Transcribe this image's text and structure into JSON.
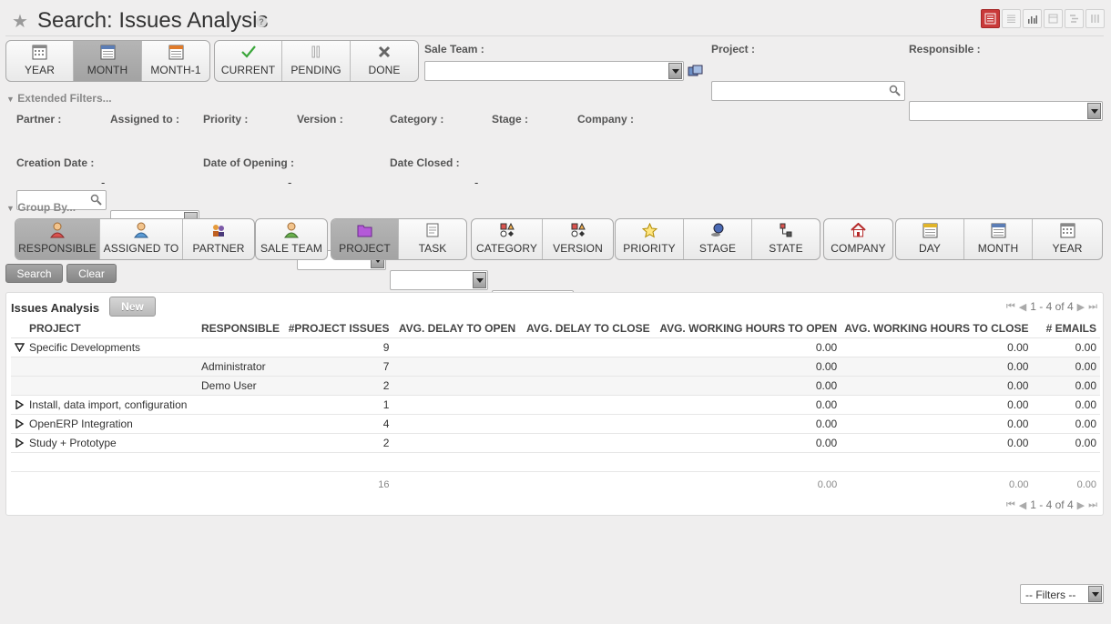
{
  "header": {
    "title": "Search: Issues Analysis",
    "help": "?"
  },
  "view_switch": [
    "list-view-icon",
    "form-view-icon",
    "graph-view-icon",
    "calendar-view-icon",
    "gantt-view-icon",
    "kanban-view-icon"
  ],
  "filters": {
    "period": [
      {
        "label": "YEAR",
        "icon": "calendar-icon",
        "active": false
      },
      {
        "label": "MONTH",
        "icon": "calendar-icon",
        "active": true
      },
      {
        "label": "MONTH-1",
        "icon": "calendar-icon",
        "active": false
      }
    ],
    "state": [
      {
        "label": "CURRENT",
        "icon": "check-icon"
      },
      {
        "label": "PENDING",
        "icon": "pause-icon"
      },
      {
        "label": "DONE",
        "icon": "cross-icon"
      }
    ]
  },
  "fields": {
    "sale_team": {
      "label": "Sale Team :",
      "value": ""
    },
    "project": {
      "label": "Project :",
      "value": ""
    },
    "responsible": {
      "label": "Responsible :",
      "value": ""
    }
  },
  "extended": {
    "toggle": "Extended Filters...",
    "partner": "Partner :",
    "assigned_to": "Assigned to :",
    "priority": "Priority :",
    "version": "Version :",
    "category": "Category :",
    "stage": "Stage :",
    "company": "Company :",
    "creation_date": "Creation Date :",
    "date_opening": "Date of Opening :",
    "date_closed": "Date Closed :",
    "dash": "-"
  },
  "group_by": {
    "toggle": "Group By...",
    "groups": [
      [
        {
          "label": "RESPONSIBLE",
          "icon": "user-icon",
          "active": true
        },
        {
          "label": "ASSIGNED TO",
          "icon": "user-icon",
          "active": false
        },
        {
          "label": "PARTNER",
          "icon": "partner-icon",
          "active": false
        }
      ],
      [
        {
          "label": "SALE TEAM",
          "icon": "user-icon",
          "active": false
        }
      ],
      [
        {
          "label": "PROJECT",
          "icon": "folder-icon",
          "active": true
        },
        {
          "label": "TASK",
          "icon": "task-icon",
          "active": false
        }
      ],
      [
        {
          "label": "CATEGORY",
          "icon": "shapes-icon",
          "active": false
        },
        {
          "label": "VERSION",
          "icon": "shapes-icon",
          "active": false
        }
      ],
      [
        {
          "label": "PRIORITY",
          "icon": "star-icon",
          "active": false
        },
        {
          "label": "STAGE",
          "icon": "stage-icon",
          "active": false
        },
        {
          "label": "STATE",
          "icon": "state-icon",
          "active": false
        }
      ],
      [
        {
          "label": "COMPANY",
          "icon": "home-icon",
          "active": false
        }
      ],
      [
        {
          "label": "DAY",
          "icon": "calendar-icon",
          "active": false
        },
        {
          "label": "MONTH",
          "icon": "calendar-icon",
          "active": false
        },
        {
          "label": "YEAR",
          "icon": "calendar-icon",
          "active": false
        }
      ]
    ]
  },
  "actions": {
    "search": "Search",
    "clear": "Clear",
    "filters_select": "-- Filters --"
  },
  "grid": {
    "title": "Issues Analysis",
    "new_label": "New",
    "pager": "1 - 4 of 4",
    "columns": [
      "PROJECT",
      "RESPONSIBLE",
      "#PROJECT ISSUES",
      "AVG. DELAY TO OPEN",
      "AVG. DELAY TO CLOSE",
      "AVG. WORKING HOURS TO OPEN",
      "AVG. WORKING HOURS TO CLOSE",
      "# EMAILS"
    ],
    "rows": [
      {
        "type": "group",
        "expanded": true,
        "project": "Specific Developments",
        "responsible": "",
        "issues": "9",
        "open": "",
        "close": "",
        "wh_open": "0.00",
        "wh_close": "0.00",
        "emails": "0.00"
      },
      {
        "type": "child",
        "project": "",
        "responsible": "Administrator",
        "issues": "7",
        "open": "",
        "close": "",
        "wh_open": "0.00",
        "wh_close": "0.00",
        "emails": "0.00"
      },
      {
        "type": "child",
        "project": "",
        "responsible": "Demo User",
        "issues": "2",
        "open": "",
        "close": "",
        "wh_open": "0.00",
        "wh_close": "0.00",
        "emails": "0.00"
      },
      {
        "type": "group",
        "expanded": false,
        "project": "Install, data import, configuration",
        "responsible": "",
        "issues": "1",
        "open": "",
        "close": "",
        "wh_open": "0.00",
        "wh_close": "0.00",
        "emails": "0.00"
      },
      {
        "type": "group",
        "expanded": false,
        "project": "OpenERP Integration",
        "responsible": "",
        "issues": "4",
        "open": "",
        "close": "",
        "wh_open": "0.00",
        "wh_close": "0.00",
        "emails": "0.00"
      },
      {
        "type": "group",
        "expanded": false,
        "project": "Study + Prototype",
        "responsible": "",
        "issues": "2",
        "open": "",
        "close": "",
        "wh_open": "0.00",
        "wh_close": "0.00",
        "emails": "0.00"
      }
    ],
    "totals": {
      "issues": "16",
      "wh_open": "0.00",
      "wh_close": "0.00",
      "emails": "0.00"
    }
  }
}
